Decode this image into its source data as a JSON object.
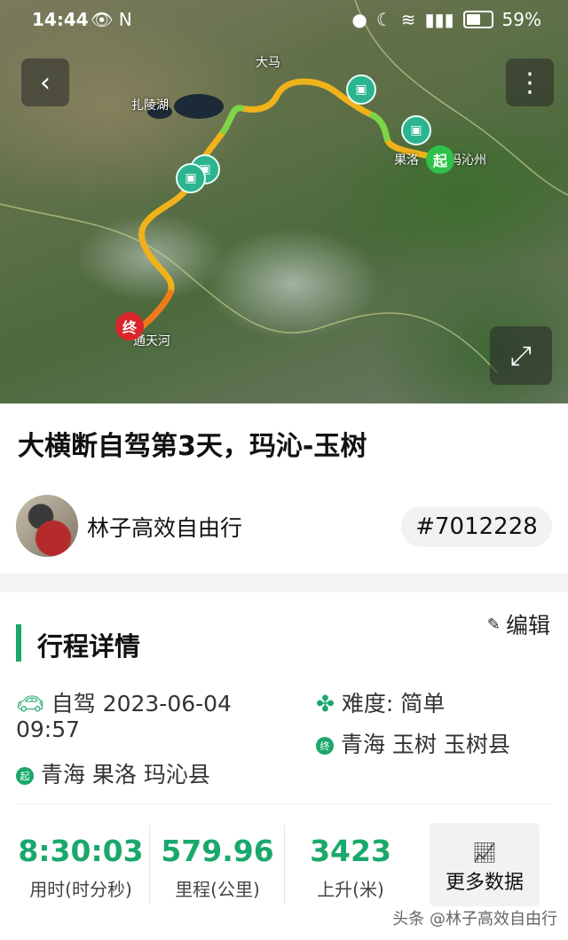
{
  "status_bar": {
    "time": "14:44",
    "left_icons": "👁 N",
    "battery_percent": "59%",
    "battery_level": 0.59
  },
  "map": {
    "labels": {
      "top": "大马",
      "lake": "扎陵湖",
      "start_place": "果洛",
      "start_place_2": "玛沁州",
      "end_place": "通天河"
    },
    "start_marker": "起",
    "end_marker": "终",
    "route_color_main": "#f5c518",
    "route_color_alt": "#f28c1a",
    "route_color_green": "#6fd14a"
  },
  "header": {
    "back_icon": "‹",
    "menu_icon": "⋮",
    "fullscreen_icon": "⤢"
  },
  "trip": {
    "title": "大横断自驾第3天，玛沁-玉树",
    "author": "林子高效自由行",
    "tag": "#7012228"
  },
  "details": {
    "section_title": "行程详情",
    "edit_label": "编辑",
    "mode": "自驾",
    "datetime_line1": "2023-06-04",
    "datetime_line2": "09:57",
    "difficulty_label": "难度:",
    "difficulty_value": "简单",
    "start_badge": "起",
    "start_location": "青海 果洛 玛沁县",
    "end_badge": "终",
    "end_location": "青海 玉树 玉树县"
  },
  "stats": [
    {
      "value": "8:30:03",
      "label": "用时(时分秒)"
    },
    {
      "value": "579.96",
      "label": "里程(公里)"
    },
    {
      "value": "3423",
      "label": "上升(米)"
    }
  ],
  "more_data": {
    "label": "更多数据"
  },
  "watermark": "头条 @林子高效自由行"
}
